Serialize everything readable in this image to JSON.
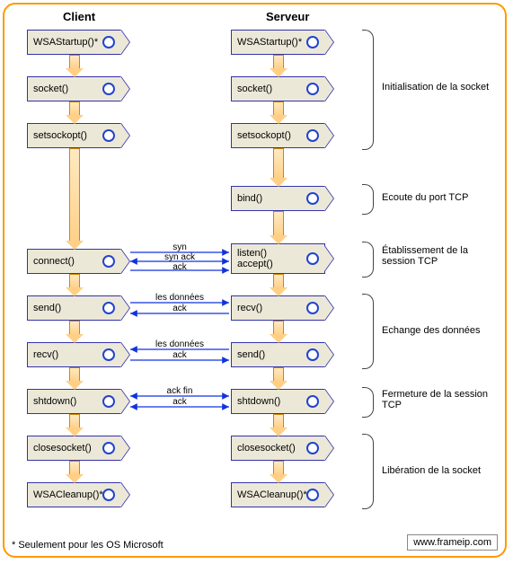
{
  "columns": {
    "client": "Client",
    "server": "Serveur"
  },
  "client_nodes": [
    "WSAStartup()*",
    "socket()",
    "setsockopt()",
    "connect()",
    "send()",
    "recv()",
    "shtdown()",
    "closesocket()",
    "WSACleanup()*"
  ],
  "server_nodes": [
    "WSAStartup()*",
    "socket()",
    "setsockopt()",
    "bind()",
    "listen()\naccept()",
    "recv()",
    "send()",
    "shtdown()",
    "closesocket()",
    "WSACleanup()*"
  ],
  "messages": {
    "connect": [
      "syn",
      "syn ack",
      "ack"
    ],
    "send": [
      "les données",
      "ack"
    ],
    "recv": [
      "les données",
      "ack"
    ],
    "shutdown": [
      "ack fin",
      "ack"
    ]
  },
  "phases": [
    "Initialisation de la socket",
    "Ecoute du port TCP",
    "Établissement de la session TCP",
    "Echange des données",
    "Fermeture de la session TCP",
    "Libération de la socket"
  ],
  "footnote": "* Seulement pour les OS Microsoft",
  "website": "www.frameip.com",
  "chart_data": {
    "type": "diagram",
    "title": "TCP client/server socket API sequence",
    "lanes": [
      "Client",
      "Serveur"
    ],
    "client_sequence": [
      "WSAStartup()*",
      "socket()",
      "setsockopt()",
      "connect()",
      "send()",
      "recv()",
      "shtdown()",
      "closesocket()",
      "WSACleanup()*"
    ],
    "server_sequence": [
      "WSAStartup()*",
      "socket()",
      "setsockopt()",
      "bind()",
      "listen()/accept()",
      "recv()",
      "send()",
      "shtdown()",
      "closesocket()",
      "WSACleanup()*"
    ],
    "horizontal_exchanges": [
      {
        "between": [
          "connect()",
          "listen()/accept()"
        ],
        "labels": [
          "syn",
          "syn ack",
          "ack"
        ],
        "directions": [
          "→",
          "←",
          "→"
        ]
      },
      {
        "between": [
          "send()",
          "recv()"
        ],
        "labels": [
          "les données",
          "ack"
        ],
        "directions": [
          "→",
          "←"
        ]
      },
      {
        "between": [
          "recv()",
          "send()"
        ],
        "labels": [
          "les données",
          "ack"
        ],
        "directions": [
          "←",
          "→"
        ]
      },
      {
        "between": [
          "shtdown()",
          "shtdown()"
        ],
        "labels": [
          "ack fin",
          "ack"
        ],
        "directions": [
          "→",
          "←"
        ]
      }
    ],
    "phase_groupings": [
      {
        "label": "Initialisation de la socket",
        "server_nodes": [
          "WSAStartup()*",
          "socket()",
          "setsockopt()"
        ]
      },
      {
        "label": "Ecoute du port TCP",
        "server_nodes": [
          "bind()"
        ]
      },
      {
        "label": "Établissement de la session TCP",
        "server_nodes": [
          "listen()/accept()"
        ]
      },
      {
        "label": "Echange des données",
        "server_nodes": [
          "recv()",
          "send()"
        ]
      },
      {
        "label": "Fermeture de la session TCP",
        "server_nodes": [
          "shtdown()"
        ]
      },
      {
        "label": "Libération de la socket",
        "server_nodes": [
          "closesocket()",
          "WSACleanup()*"
        ]
      }
    ]
  }
}
